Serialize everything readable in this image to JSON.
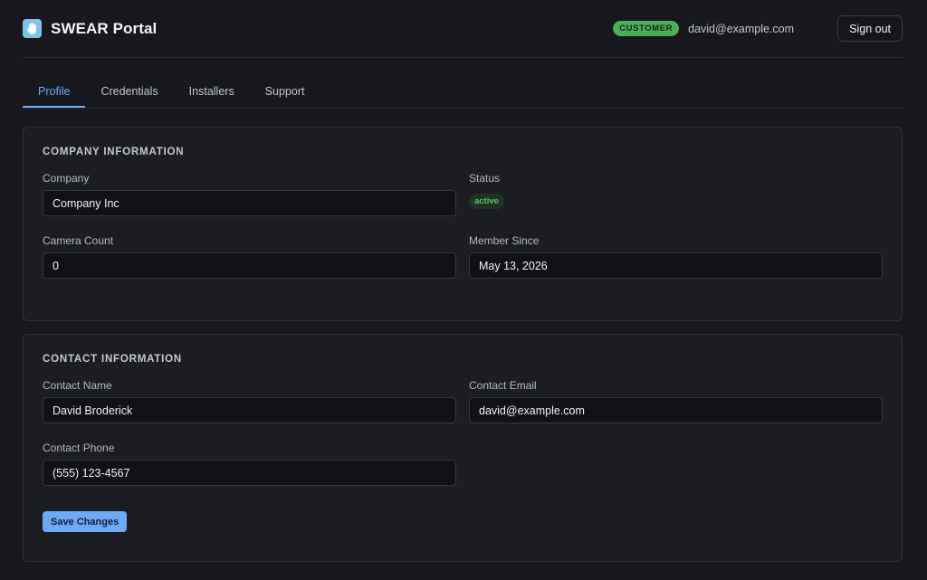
{
  "header": {
    "app_title": "SWEAR Portal",
    "logo_icon": "hand-icon",
    "role_badge": "CUSTOMER",
    "user_email": "david@example.com",
    "sign_out_label": "Sign out"
  },
  "tabs": [
    {
      "label": "Profile",
      "active": true
    },
    {
      "label": "Credentials",
      "active": false
    },
    {
      "label": "Installers",
      "active": false
    },
    {
      "label": "Support",
      "active": false
    }
  ],
  "company": {
    "section_title": "COMPANY INFORMATION",
    "company_label": "Company",
    "company_value": "Company Inc",
    "status_label": "Status",
    "status_value": "active",
    "camera_count_label": "Camera Count",
    "camera_count_value": "0",
    "member_since_label": "Member Since",
    "member_since_value": "May 13, 2026"
  },
  "contact": {
    "section_title": "CONTACT INFORMATION",
    "name_label": "Contact Name",
    "name_value": "David Broderick",
    "email_label": "Contact Email",
    "email_value": "david@example.com",
    "phone_label": "Contact Phone",
    "phone_value": "(555) 123-4567",
    "save_label": "Save Changes"
  },
  "colors": {
    "accent": "#6fa8f5",
    "success": "#4cae5a",
    "background": "#16181d",
    "card": "#1b1d23"
  }
}
